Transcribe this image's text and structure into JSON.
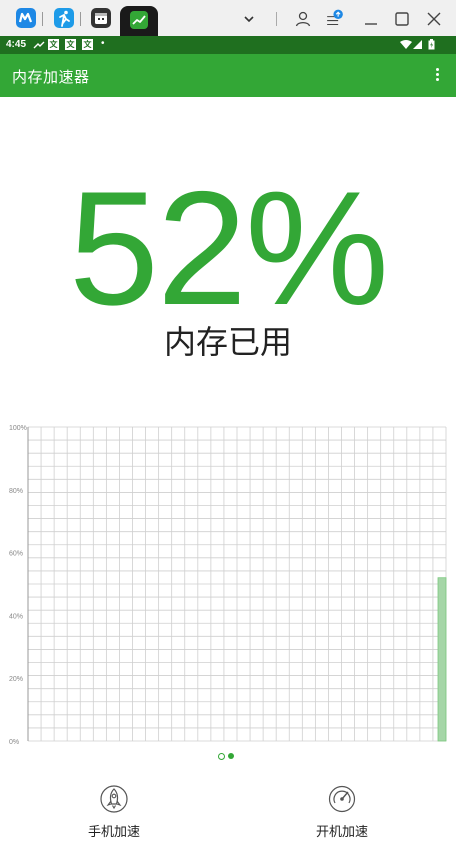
{
  "host_tabs": [
    {
      "icon": "m-app-icon",
      "color": "#1e88e5"
    },
    {
      "icon": "runner-app-icon",
      "color": "#1e9be8"
    },
    {
      "icon": "calendar-app-icon",
      "color": "#333333"
    },
    {
      "icon": "chart-app-icon",
      "color": "#33a736",
      "active": true
    }
  ],
  "host_controls": [
    "chevron-down-icon",
    "user-icon",
    "menu-upload-icon",
    "minimize-icon",
    "maximize-icon",
    "close-icon"
  ],
  "status_bar": {
    "time": "4:45",
    "notifications": [
      "文",
      "文",
      "文"
    ],
    "dot": "•"
  },
  "toolbar": {
    "title": "内存加速器"
  },
  "memory": {
    "percent_text": "52%",
    "label": "内存已用"
  },
  "chart_data": {
    "type": "bar",
    "ylim": [
      0,
      100
    ],
    "yticks": [
      "0%",
      "20%",
      "40%",
      "60%",
      "80%",
      "100%"
    ],
    "grid": true,
    "values": [
      52
    ],
    "bar_color": "#a5d6a7"
  },
  "pager": {
    "pages": 2,
    "active": 1
  },
  "bottom_buttons": [
    {
      "label": "手机加速",
      "icon": "rocket-icon"
    },
    {
      "label": "开机加速",
      "icon": "power-dial-icon"
    }
  ]
}
